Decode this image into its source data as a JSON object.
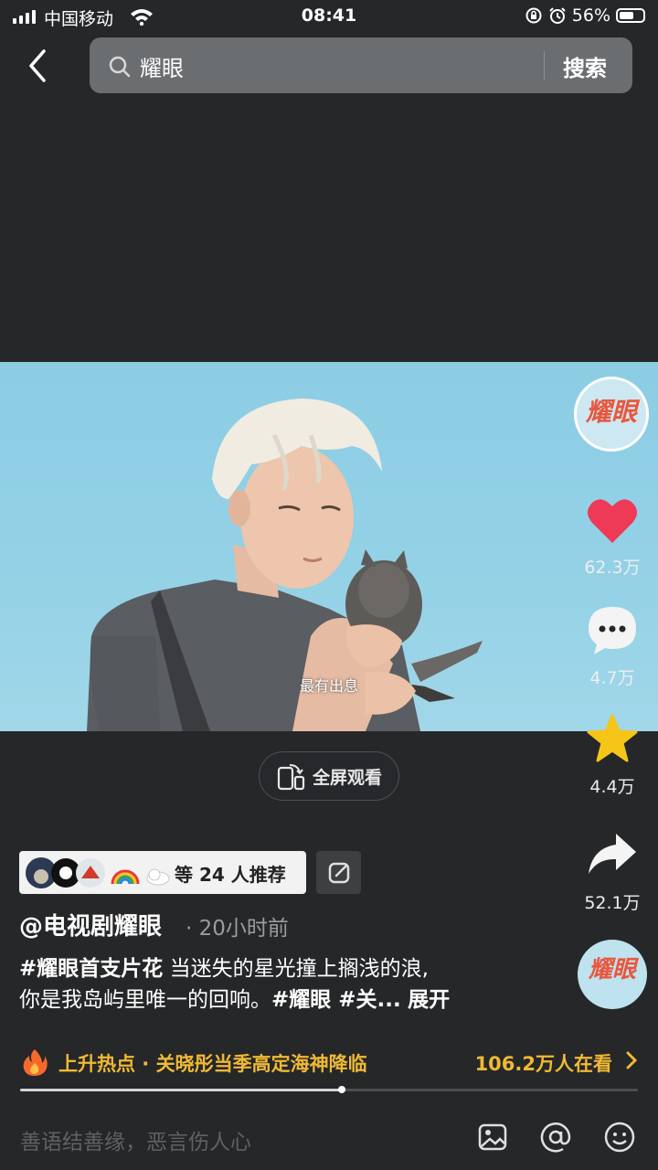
{
  "status_bar": {
    "carrier": "中国移动",
    "time": "08:41",
    "battery": "56%"
  },
  "search": {
    "query": "耀眼",
    "button_label": "搜索"
  },
  "video": {
    "subtitle": "最有出息"
  },
  "fullscreen": {
    "label": "全屏观看"
  },
  "rail": {
    "account_logo": "耀眼",
    "likes": "62.3万",
    "comments": "4.7万",
    "favorites": "4.4万",
    "shares": "52.1万"
  },
  "recommend": {
    "text": "等 24 人推荐"
  },
  "post": {
    "author": "@电视剧耀眼",
    "time_ago": "20小时前",
    "hashtag": "#耀眼首支片花",
    "line1": "当迷失的星光撞上搁浅的浪,",
    "line2": "你是我岛屿里唯一的回响。",
    "tags": "#耀眼 #关...",
    "expand": "展开"
  },
  "hot": {
    "title": "上升热点 · 关晓彤当季高定海神降临",
    "viewers": "106.2万人在看",
    "progress_fraction": 0.52
  },
  "comment": {
    "placeholder": "善语结善缘，恶言伤人心"
  },
  "colors": {
    "like": "#ee3a57",
    "favorite": "#f5c518",
    "hot": "#f0b934",
    "background": "#252729"
  }
}
